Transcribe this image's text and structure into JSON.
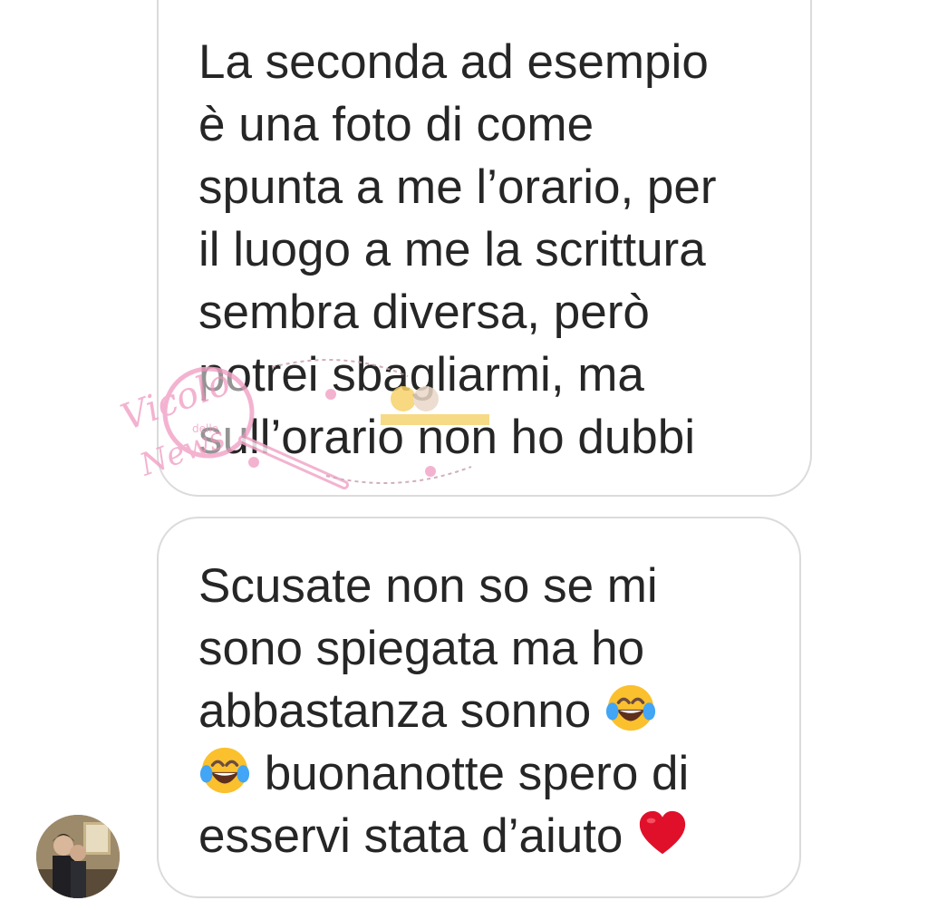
{
  "messages": [
    {
      "lines": [
        "La seconda ad esempio",
        "è una foto di come",
        "spunta a me l’orario, per",
        "il luogo a me la scrittura",
        "sembra diversa, però",
        "potrei sbagliarmi, ma",
        "sull’orario non ho dubbi"
      ]
    },
    {
      "lines": [
        "Scusate non so se mi",
        "sono spiegata ma ho",
        "abbastanza sonno",
        "buonanotte spero di",
        "esservi stata d’aiuto"
      ],
      "emojis": [
        "face-with-tears-of-joy",
        "face-with-tears-of-joy",
        "red-heart"
      ]
    }
  ],
  "watermark": {
    "text_top": "Vicolo",
    "text_small": "delle",
    "text_bottom": "News"
  },
  "colors": {
    "bubble_border": "#dbdbdb",
    "text": "#262626",
    "background": "#ffffff",
    "heart": "#e0102a",
    "emoji_face": "#fbc02d",
    "watermark_pink": "#f2a6c8"
  }
}
